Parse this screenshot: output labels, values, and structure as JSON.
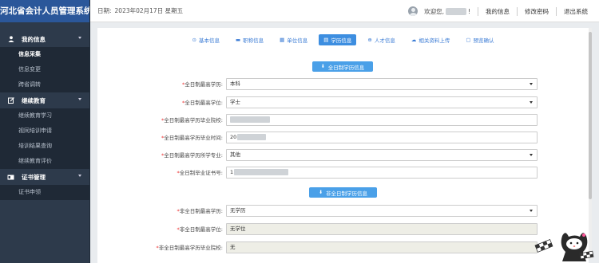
{
  "app": {
    "title": "河北省会计人员管理系统"
  },
  "sidebar": {
    "groups": [
      {
        "label": "我的信息",
        "icon": "user-icon",
        "items": [
          {
            "label": "信息采集",
            "active": true
          },
          {
            "label": "信息变更",
            "active": false
          },
          {
            "label": "跨省调转",
            "active": false
          }
        ]
      },
      {
        "label": "继续教育",
        "icon": "edit-icon",
        "items": [
          {
            "label": "继续教育学习",
            "active": false
          },
          {
            "label": "视同培训申请",
            "active": false
          },
          {
            "label": "培训结果查询",
            "active": false
          },
          {
            "label": "继续教育评价",
            "active": false
          }
        ]
      },
      {
        "label": "证书管理",
        "icon": "id-card-icon",
        "items": [
          {
            "label": "证书申领",
            "active": false
          }
        ]
      }
    ]
  },
  "topbar": {
    "date_label": "日期:",
    "date_value": "2023年02月17日 星期五",
    "welcome": "欢迎您,",
    "welcome_suffix": "!",
    "links": [
      "我的信息",
      "修改密码",
      "退出系统"
    ]
  },
  "tabs": [
    {
      "label": "基本信息",
      "icon": "⊙",
      "active": false
    },
    {
      "label": "职称信息",
      "icon": "▬",
      "active": false
    },
    {
      "label": "单位信息",
      "icon": "▦",
      "active": false
    },
    {
      "label": "学历信息",
      "icon": "▤",
      "active": true
    },
    {
      "label": "人才信息",
      "icon": "⊕",
      "active": false
    },
    {
      "label": "相关资料上传",
      "icon": "☁",
      "active": false
    },
    {
      "label": "预览确认",
      "icon": "▢",
      "active": false
    }
  ],
  "sections": {
    "fulltime_button": "全日制学历信息",
    "parttime_button": "非全日制学历信息"
  },
  "fulltime_fields": [
    {
      "label": "全日制最高学历:",
      "value": "本科",
      "type": "select"
    },
    {
      "label": "全日制最高学位:",
      "value": "学士",
      "type": "select"
    },
    {
      "label": "全日制最高学历毕业院校:",
      "value": "",
      "type": "text",
      "blurred": true
    },
    {
      "label": "全日制最高学历毕业时间:",
      "value": "20",
      "type": "text",
      "blurred": true
    },
    {
      "label": "全日制最高学历所学专业:",
      "value": "其他",
      "type": "select"
    },
    {
      "label": "全日制毕业证书号:",
      "value": "1",
      "type": "text",
      "blurred": true
    }
  ],
  "parttime_fields": [
    {
      "label": "非全日制最高学历:",
      "value": "无学历",
      "type": "select"
    },
    {
      "label": "非全日制最高学位:",
      "value": "无学位",
      "type": "readonly"
    },
    {
      "label": "非全日制最高学历毕业院校:",
      "value": "无",
      "type": "readonly"
    }
  ],
  "colors": {
    "sidebar": "#2d3a4b",
    "brand": "#2b579a",
    "accent": "#3d8ee0",
    "required": "#e33333"
  }
}
